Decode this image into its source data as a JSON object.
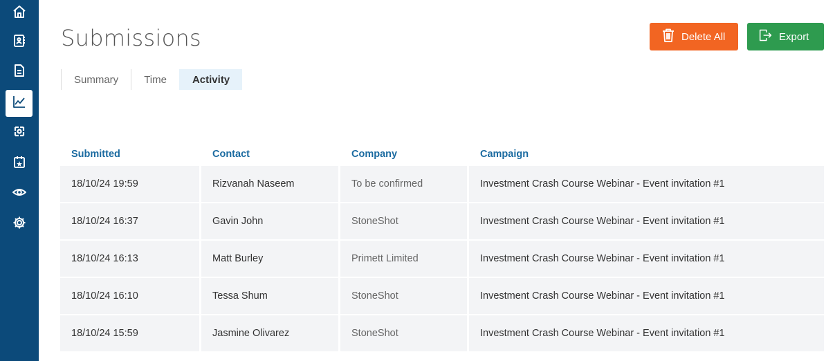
{
  "sidebar": {
    "items": [
      {
        "icon": "home-icon"
      },
      {
        "icon": "contacts-book-icon"
      },
      {
        "icon": "document-icon"
      },
      {
        "icon": "chart-line-icon",
        "active": true
      },
      {
        "icon": "recycle-arrows-icon"
      },
      {
        "icon": "calendar-star-icon"
      },
      {
        "icon": "eye-icon"
      },
      {
        "icon": "gear-icon"
      }
    ],
    "bg_color": "#0c4a7a"
  },
  "header": {
    "title": "Submissions",
    "delete_all_label": "Delete All",
    "export_label": "Export",
    "delete_color": "#f26522",
    "export_color": "#2e9b4f"
  },
  "tabs": [
    {
      "label": "Summary"
    },
    {
      "label": "Time"
    },
    {
      "label": "Activity",
      "active": true
    }
  ],
  "table": {
    "columns": [
      "Submitted",
      "Contact",
      "Company",
      "Campaign"
    ],
    "rows": [
      {
        "submitted": "18/10/24 19:59",
        "contact": "Rizvanah Naseem",
        "company": "To be confirmed",
        "campaign": "Investment Crash Course Webinar - Event invitation #1"
      },
      {
        "submitted": "18/10/24 16:37",
        "contact": "Gavin John",
        "company": "StoneShot",
        "campaign": "Investment Crash Course Webinar - Event invitation #1"
      },
      {
        "submitted": "18/10/24 16:13",
        "contact": "Matt Burley",
        "company": "Primett Limited",
        "campaign": "Investment Crash Course Webinar - Event invitation #1"
      },
      {
        "submitted": "18/10/24 16:10",
        "contact": "Tessa Shum",
        "company": "StoneShot",
        "campaign": "Investment Crash Course Webinar - Event invitation #1"
      },
      {
        "submitted": "18/10/24 15:59",
        "contact": "Jasmine Olivarez",
        "company": "StoneShot",
        "campaign": "Investment Crash Course Webinar - Event invitation #1"
      }
    ]
  }
}
